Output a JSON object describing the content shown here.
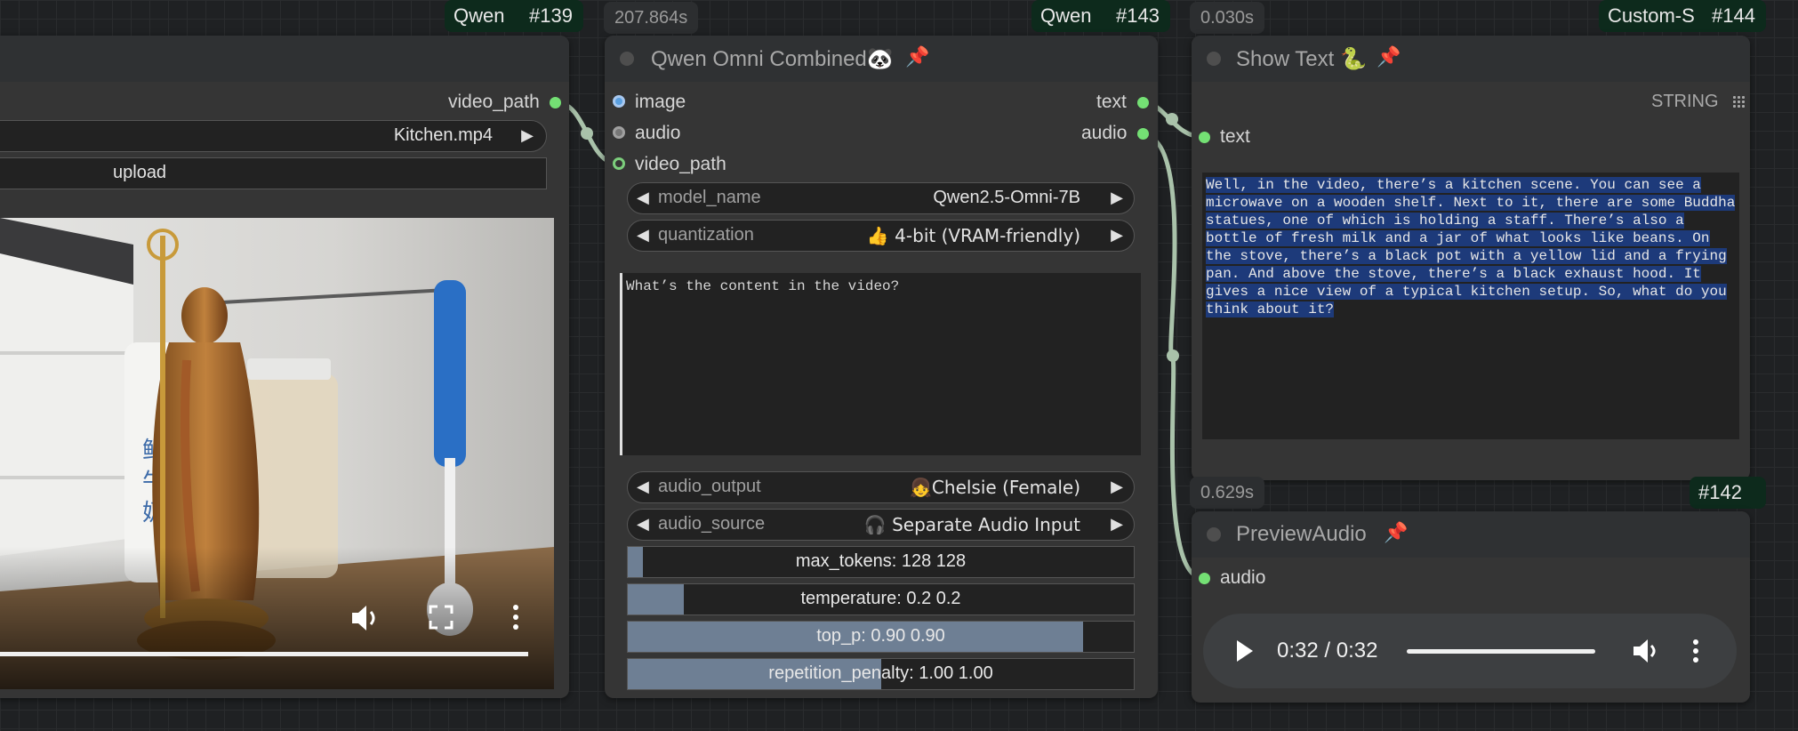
{
  "node139": {
    "badge_prefix": "Qwen",
    "badge_id": "#139",
    "output_label": "video_path",
    "video_select": "Kitchen.mp4",
    "upload_label": "upload",
    "player_icons": {
      "volume": "volume-icon",
      "fullscreen": "fullscreen-icon",
      "more": "more-icon"
    },
    "progress": 1.0
  },
  "node143": {
    "timer": "207.864s",
    "badge_prefix": "Qwen",
    "badge_id": "#143",
    "title": "Qwen Omni Combined",
    "title_emoji": "🐼",
    "pin": "📌",
    "inputs": [
      "image",
      "audio",
      "video_path"
    ],
    "outputs": [
      "text",
      "audio"
    ],
    "model_name": {
      "name": "model_name",
      "value": "Qwen2.5-Omni-7B"
    },
    "quantization": {
      "name": "quantization",
      "value": "👍 4-bit (VRAM-friendly)"
    },
    "prompt": "What’s the content in the video?",
    "audio_output": {
      "name": "audio_output",
      "value": "👧Chelsie (Female)"
    },
    "audio_source": {
      "name": "audio_source",
      "value": "🎧 Separate Audio Input"
    },
    "sliders": [
      {
        "label": "max_tokens: 128  128",
        "fraction": 0.03
      },
      {
        "label": "temperature: 0.2  0.2",
        "fraction": 0.11
      },
      {
        "label": "top_p: 0.90  0.90",
        "fraction": 0.9
      },
      {
        "label": "repetition_penalty: 1.00  1.00",
        "fraction": 0.5
      }
    ]
  },
  "node144": {
    "timer": "0.030s",
    "badge_prefix": "Custom-S",
    "badge_id": "#144",
    "title": "Show Text",
    "title_emoji": "🐍",
    "pin": "📌",
    "input_label": "text",
    "type_label": "STRING",
    "output_text": "Well, in the video, there’s a kitchen scene. You can see a microwave on a wooden shelf. Next to it, there are some Buddha statues, one of which is holding a staff. There’s also a bottle of fresh milk and a jar of what looks like beans. On the stove, there’s a black pot with a yellow lid and a frying pan. And above the stove, there’s a black exhaust hood. It gives a nice view of a typical kitchen setup. So, what do you think about it?"
  },
  "node142": {
    "timer": "0.629s",
    "badge_id": "#142",
    "title": "PreviewAudio",
    "pin": "📌",
    "input_label": "audio",
    "time_display": "0:32 / 0:32",
    "progress": 1.0,
    "icons": {
      "play": "play-icon",
      "volume": "volume-icon",
      "more": "more-icon"
    }
  }
}
